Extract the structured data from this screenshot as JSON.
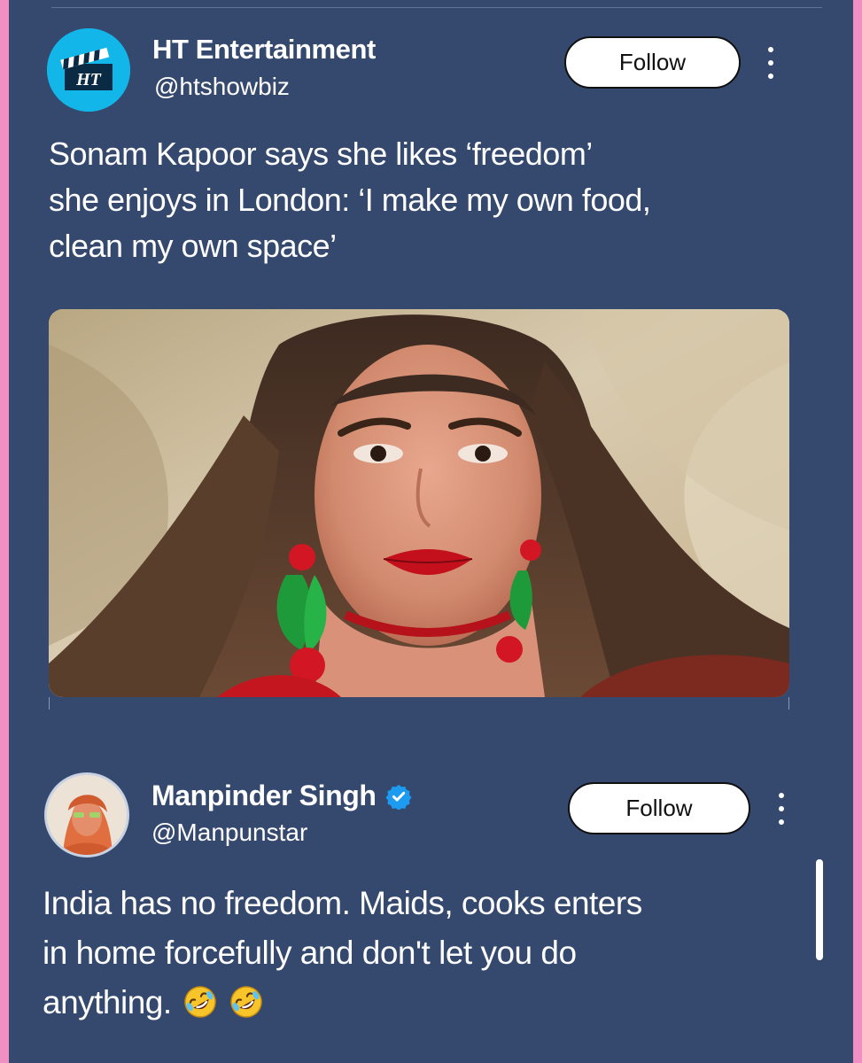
{
  "post1": {
    "author_name": "HT Entertainment",
    "author_handle": "@htshowbiz",
    "avatar_icon": "ht-clapperboard-logo",
    "avatar_logo_text": "HT",
    "follow_label": "Follow",
    "text_lines": [
      "Sonam Kapoor says she likes ‘freedom’",
      "she enjoys in London: ‘I make my own food,",
      "clean my own space’"
    ],
    "media": "photo-woman-red-lips-green-earrings"
  },
  "post2": {
    "author_name": "Manpinder Singh",
    "verified": true,
    "author_handle": "@Manpunstar",
    "follow_label": "Follow",
    "text_lines": [
      "India has no freedom. Maids, cooks enters",
      "in home forcefully and don't let you do",
      "anything."
    ],
    "emoji": [
      "rolling-on-floor-laughing-emoji",
      "rolling-on-floor-laughing-emoji"
    ]
  },
  "colors": {
    "background": "#35496f",
    "border": "#f08fc3",
    "verified": "#1d9bf0",
    "ht_logo": "#12b6e9"
  }
}
